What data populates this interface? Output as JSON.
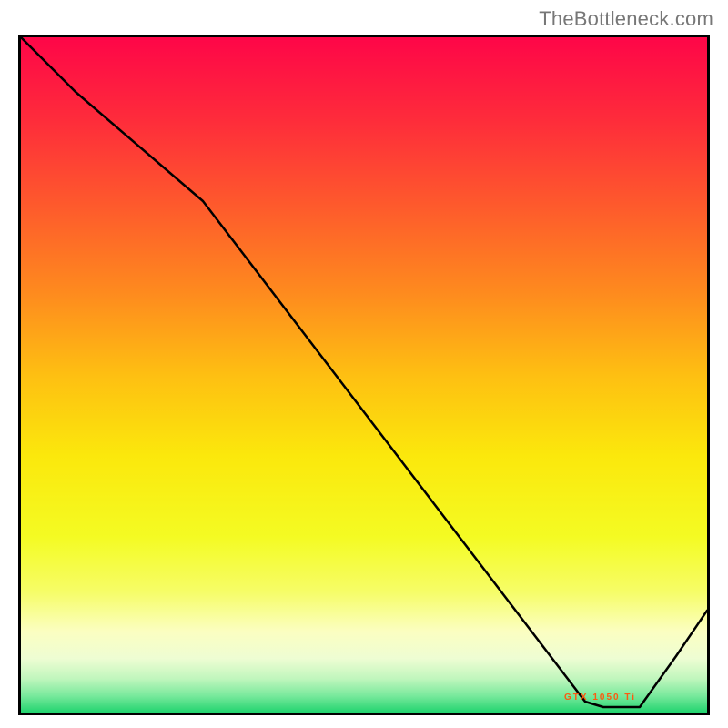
{
  "watermark": "TheBottleneck.com",
  "chart_data": {
    "type": "line",
    "title": "",
    "xlabel": "",
    "ylabel": "",
    "xlim": [
      0,
      100
    ],
    "ylim": [
      0,
      100
    ],
    "marker_label": "GTX 1050 Ti",
    "x": [
      0,
      8,
      27,
      82,
      85,
      90,
      95,
      100
    ],
    "values": [
      100,
      92,
      76,
      2,
      1,
      1,
      8,
      15
    ],
    "background": {
      "type": "vertical-gradient",
      "stops": [
        {
          "pct": 0,
          "color": "#fe0648"
        },
        {
          "pct": 12,
          "color": "#fe2b3b"
        },
        {
          "pct": 25,
          "color": "#fe5a2c"
        },
        {
          "pct": 38,
          "color": "#fe8b1e"
        },
        {
          "pct": 50,
          "color": "#febf12"
        },
        {
          "pct": 62,
          "color": "#fbe80c"
        },
        {
          "pct": 74,
          "color": "#f4fb23"
        },
        {
          "pct": 82,
          "color": "#f6fd66"
        },
        {
          "pct": 88,
          "color": "#fbfec1"
        },
        {
          "pct": 92,
          "color": "#eefdd3"
        },
        {
          "pct": 95,
          "color": "#c0f6bd"
        },
        {
          "pct": 97.5,
          "color": "#79e99c"
        },
        {
          "pct": 100,
          "color": "#22d46f"
        }
      ]
    },
    "line_color": "#000000",
    "frame_color": "#000000"
  }
}
